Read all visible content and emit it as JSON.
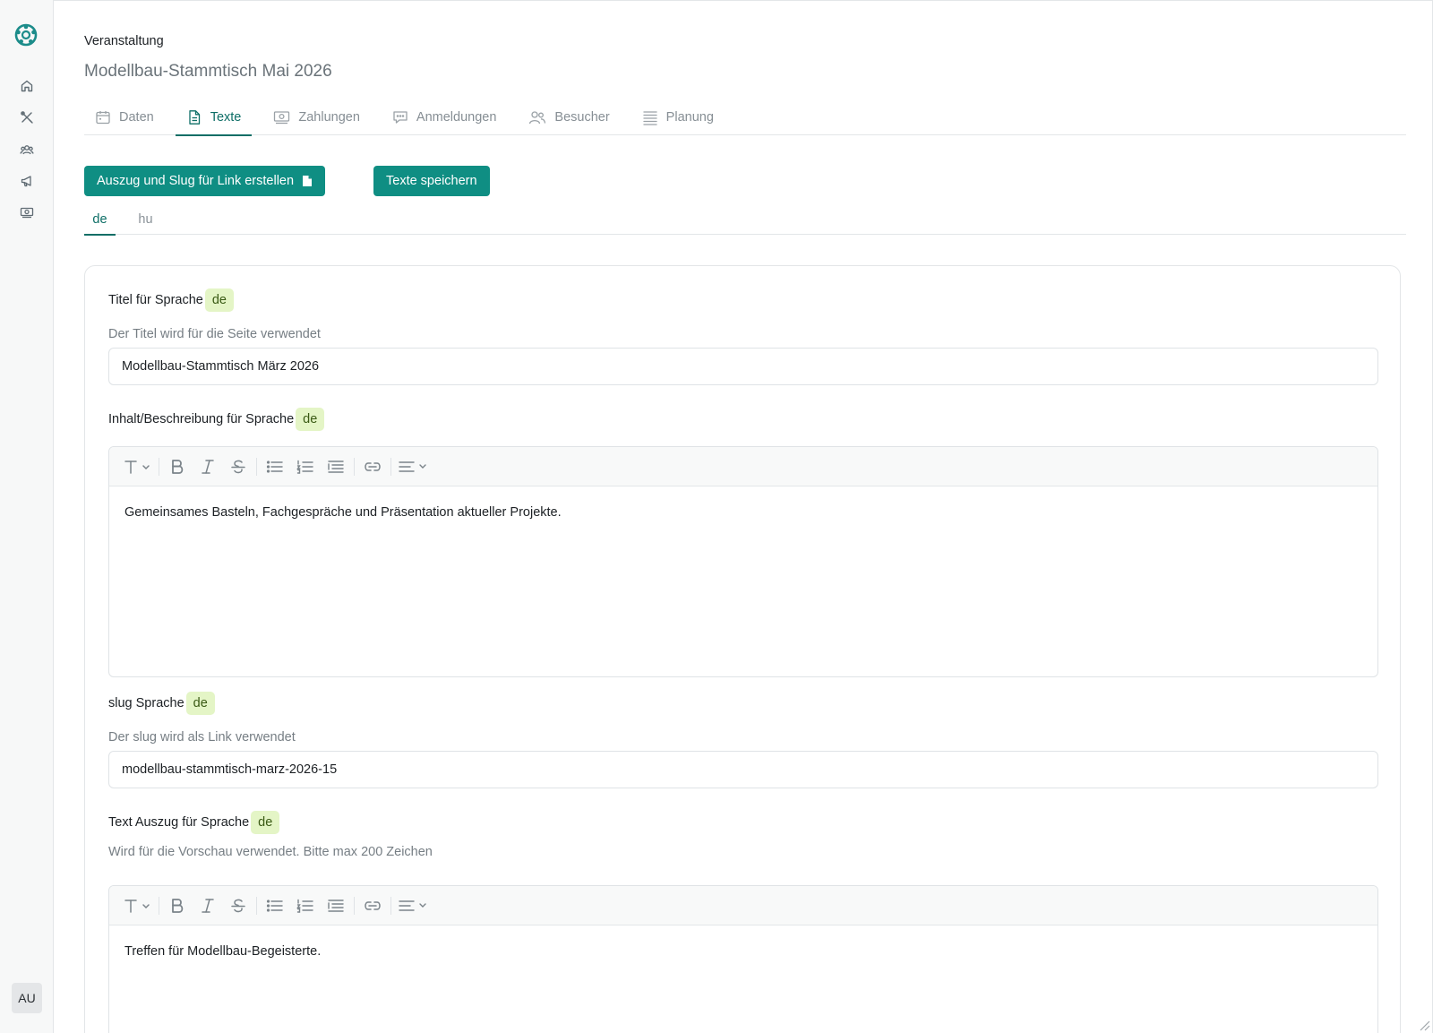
{
  "sidebar": {
    "user_initials": "AU"
  },
  "header": {
    "label": "Veranstaltung",
    "title": "Modellbau-Stammtisch Mai 2026"
  },
  "tabs": [
    {
      "label": "Daten",
      "icon": "calendar-icon"
    },
    {
      "label": "Texte",
      "icon": "document-icon",
      "active": true
    },
    {
      "label": "Zahlungen",
      "icon": "money-icon"
    },
    {
      "label": "Anmeldungen",
      "icon": "chat-icon"
    },
    {
      "label": "Besucher",
      "icon": "users-icon"
    },
    {
      "label": "Planung",
      "icon": "list-icon"
    }
  ],
  "actions": {
    "generate_label": "Auszug und Slug für Link erstellen",
    "save_label": "Texte speichern"
  },
  "languages": [
    {
      "label": "de",
      "active": true
    },
    {
      "label": "hu"
    }
  ],
  "form": {
    "title": {
      "label": "Titel für Sprache",
      "lang": "de",
      "hint": "Der Titel wird für die Seite verwendet",
      "value": "Modellbau-Stammtisch März 2026"
    },
    "content": {
      "label": "Inhalt/Beschreibung für Sprache",
      "lang": "de",
      "value": "Gemeinsames Basteln, Fachgespräche und Präsentation aktueller Projekte."
    },
    "slug": {
      "label": "slug Sprache",
      "lang": "de",
      "hint": "Der slug wird als Link verwendet",
      "value": "modellbau-stammtisch-marz-2026-15"
    },
    "excerpt": {
      "label": "Text Auszug für Sprache",
      "lang": "de",
      "hint": "Wird für die Vorschau verwendet. Bitte max 200 Zeichen",
      "value": "Treffen für Modellbau-Begeisterte."
    }
  },
  "colors": {
    "primary": "#0f8e83",
    "active_tab": "#0d6e66",
    "badge_bg": "#e4f5c6"
  }
}
